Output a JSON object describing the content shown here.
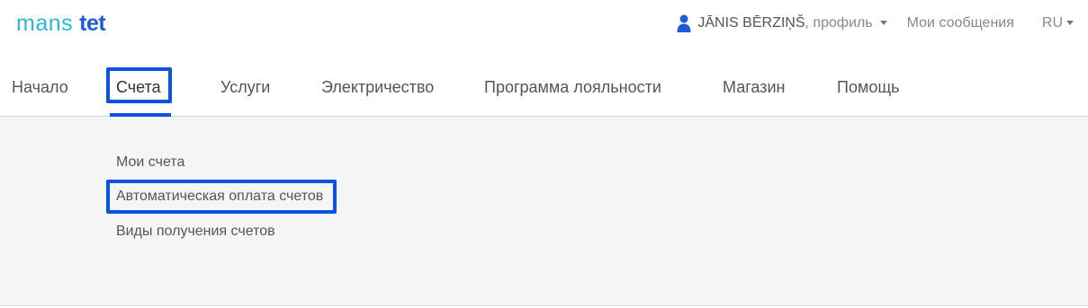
{
  "logo": {
    "mans": "mans",
    "tet": "tet"
  },
  "top": {
    "user_icon": "user-icon",
    "user_name": "JĀNIS BĒRZIŅŠ",
    "profile_suffix": ", профиль",
    "messages": "Мои сообщения",
    "language": "RU"
  },
  "nav": {
    "items": [
      {
        "label": "Начало"
      },
      {
        "label": "Счета"
      },
      {
        "label": "Услуги"
      },
      {
        "label": "Электричество"
      },
      {
        "label": "Программа лояльности"
      },
      {
        "label": "Магазин"
      },
      {
        "label": "Помощь"
      }
    ],
    "active": "Счета"
  },
  "submenu": {
    "items": [
      {
        "label": "Мои счета"
      },
      {
        "label": "Автоматическая оплата счетов"
      },
      {
        "label": "Виды получения счетов"
      }
    ],
    "highlighted": "Автоматическая оплата счетов"
  },
  "colors": {
    "accent": "#0a52e0",
    "logo_mans": "#2bb8d6",
    "logo_tet": "#1f5bd8",
    "submenu_bg": "#f5f5f5"
  }
}
